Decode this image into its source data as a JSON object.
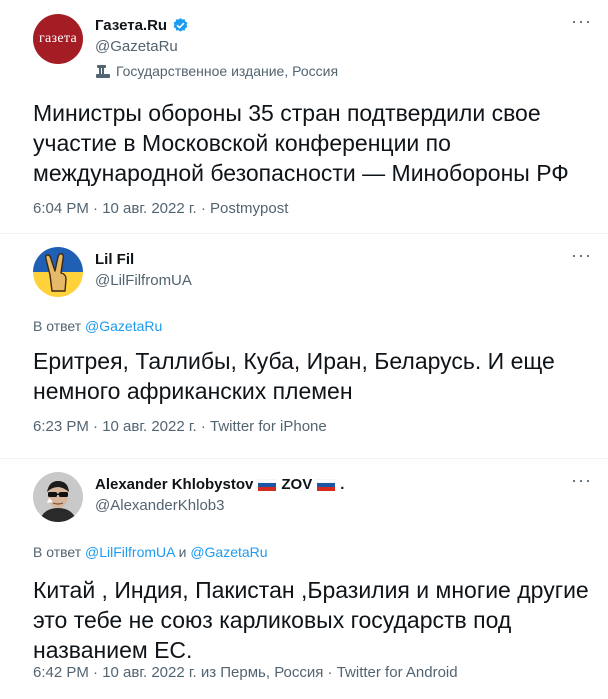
{
  "tweets": [
    {
      "display_name": "Газета.Ru",
      "handle": "@GazetaRu",
      "avatar_text": "газета",
      "verified": true,
      "state_label": "Государственное издание, Россия",
      "text": "Министры обороны 35 стран подтвердили свое\nучастие в Московской конференции по\nмеждународной безопасности — Минобороны РФ",
      "meta": "6:04 PM · 10 авг. 2022 г. · Postmypost"
    },
    {
      "display_name": "Lil Fil",
      "handle": "@LilFilfromUA",
      "reply_prefix": "В ответ ",
      "reply_link_1": "@GazetaRu",
      "text": "Еритрея, Таллибы, Куба, Иран, Беларусь. И еще\nнемного африканских племен",
      "meta": "6:23 PM · 10 авг. 2022 г. · Twitter for iPhone"
    },
    {
      "display_name": "Alexander Khlobystov",
      "name_suffix_1": "ZOV",
      "name_suffix_2": ".",
      "handle": "@AlexanderKhlob3",
      "reply_prefix": "В ответ ",
      "reply_link_1": "@LilFilfromUA",
      "reply_and": " и ",
      "reply_link_2": "@GazetaRu",
      "text": "Китай , Индия, Пакистан ,Бразилия и многие другие\nэто тебе не союз карликовых государств под\nназванием ЕС.",
      "meta": "6:42 PM · 10 авг. 2022 г. из Пермь, Россия · Twitter for Android"
    }
  ],
  "more_glyph": "···",
  "colors": {
    "text": "#0f1419",
    "secondary": "#536471",
    "link": "#1d9bf0",
    "gazeta_red": "#a51d24",
    "ua_blue": "#1f5fb4",
    "ua_yellow": "#ffd23c"
  },
  "icons": [
    "verified-badge-icon",
    "state-media-icon",
    "more-options-icon",
    "russia-flag-icon"
  ]
}
